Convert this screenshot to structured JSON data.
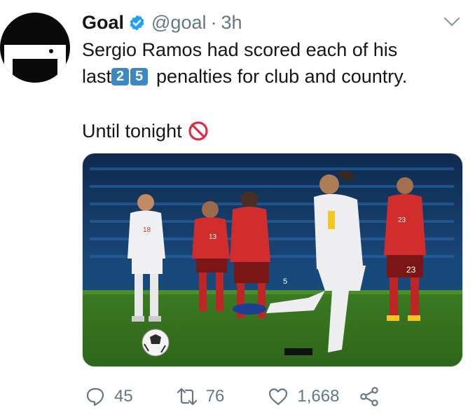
{
  "account": {
    "name": "Goal",
    "handle": "@goal",
    "separator": "·",
    "time": "3h",
    "verified": true,
    "avatar_icon": "goal-logo"
  },
  "tweet": {
    "line1": "Sergio Ramos had scored each of his",
    "line2_before": "last",
    "keycaps": [
      "2",
      "5"
    ],
    "line2_after": "penalties for club and country.",
    "line3": "Until tonight",
    "line3_emoji": "no-entry-sign-icon"
  },
  "media": {
    "description_icon": "football-penalty-photo",
    "jersey_numbers": [
      "18",
      "13",
      "5",
      "23",
      "23"
    ]
  },
  "actions": {
    "replies": "45",
    "retweets": "76",
    "likes": "1,668"
  },
  "colors": {
    "verified_blue": "#1da1f2",
    "keycap_blue": "#3b88c3",
    "muted_gray": "#657786",
    "no_entry_red": "#dd2e44"
  }
}
